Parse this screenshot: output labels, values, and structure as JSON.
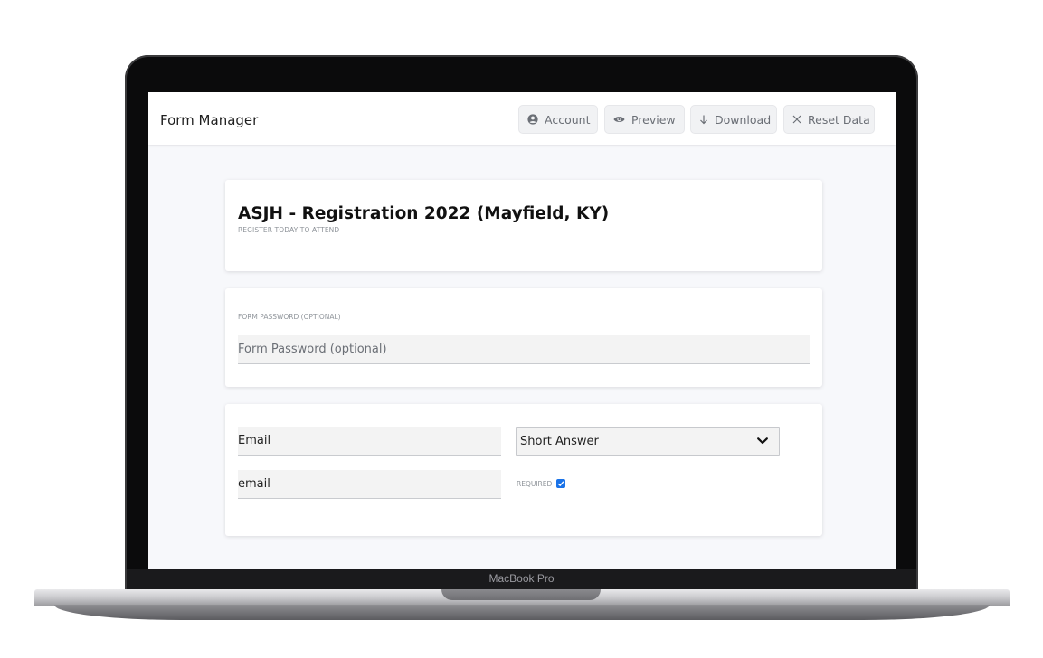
{
  "device": {
    "label": "MacBook Pro"
  },
  "header": {
    "title": "Form Manager",
    "buttons": {
      "account": {
        "label": "Account",
        "icon": "account-circle-icon"
      },
      "preview": {
        "label": "Preview",
        "icon": "eye-icon"
      },
      "download": {
        "label": "Download",
        "icon": "arrow-down-icon"
      },
      "reset": {
        "label": "Reset Data",
        "icon": "close-icon"
      }
    }
  },
  "form": {
    "title": "ASJH - Registration 2022 (Mayfield, KY)",
    "subtitle": "REGISTER TODAY TO ATTEND"
  },
  "password": {
    "label": "FORM PASSWORD (OPTIONAL)",
    "placeholder": "Form Password (optional)",
    "value": ""
  },
  "field": {
    "label_value": "Email",
    "name_value": "email",
    "type_selected": "Short Answer",
    "required_label": "REQUIRED",
    "required_checked": true
  },
  "colors": {
    "accent": "#1a73e8",
    "screen_bg": "#f7f8fb",
    "input_bg": "#f3f3f3"
  }
}
